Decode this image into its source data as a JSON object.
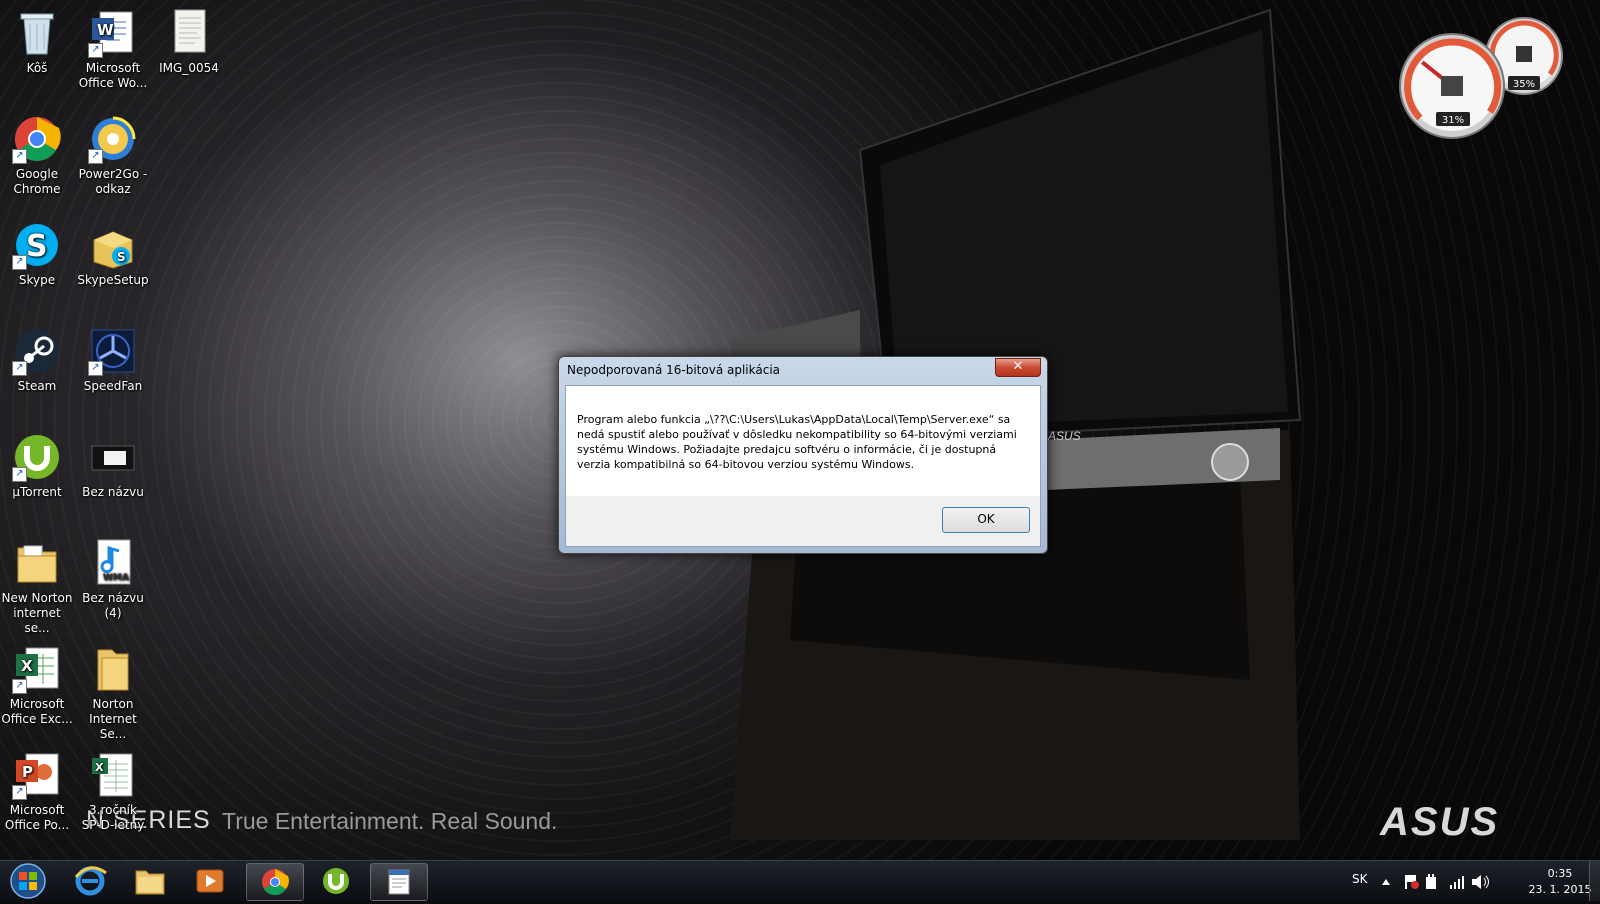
{
  "desktop": {
    "icons": [
      {
        "label": "Kôš"
      },
      {
        "label": "Microsoft\nOffice Wo..."
      },
      {
        "label": "IMG_0054"
      },
      {
        "label": "Google\nChrome"
      },
      {
        "label": "Power2Go -\nodkaz"
      },
      {
        "label": "Skype"
      },
      {
        "label": "SkypeSetup"
      },
      {
        "label": "Steam"
      },
      {
        "label": "SpeedFan"
      },
      {
        "label": "µTorrent"
      },
      {
        "label": "Bez názvu"
      },
      {
        "label": "New Norton\ninternet se..."
      },
      {
        "label": "Bez názvu (4)"
      },
      {
        "label": "Microsoft\nOffice Exc..."
      },
      {
        "label": "Norton\nInternet Se..."
      },
      {
        "label": "Microsoft\nOffice Po..."
      },
      {
        "label": "3.ročník\nSP-D-letný"
      }
    ],
    "wma_badge": "WMA"
  },
  "wallpaper": {
    "series": "N SERIES",
    "tagline": "True Entertainment. Real Sound.",
    "logo": "ASUS",
    "laptop_brand": "ASUS"
  },
  "gadget": {
    "cpu_percent": "31%",
    "memory_percent": "35%",
    "cpu_value": 0.31,
    "memory_value": 0.35
  },
  "dialog": {
    "title": "Nepodporovaná 16-bitová aplikácia",
    "close_label": "✕",
    "message": "Program alebo funkcia „\\??\\C:\\Users\\Lukas\\AppData\\Local\\Temp\\Server.exe“ sa nedá spustiť alebo používať v dôsledku nekompatibility so 64-bitovými verziami systému Windows. Požiadajte predajcu softvéru o informácie, či je dostupná verzia kompatibilná so 64-bitovou verziou systému Windows.",
    "ok_label": "OK"
  },
  "taskbar": {
    "language": "SK",
    "time": "0:35",
    "date": "23. 1. 2015"
  },
  "colors": {
    "dialog_accent": "#3c7fb1",
    "close_red": "#c84c34",
    "taskbar": "#0b0e12"
  }
}
